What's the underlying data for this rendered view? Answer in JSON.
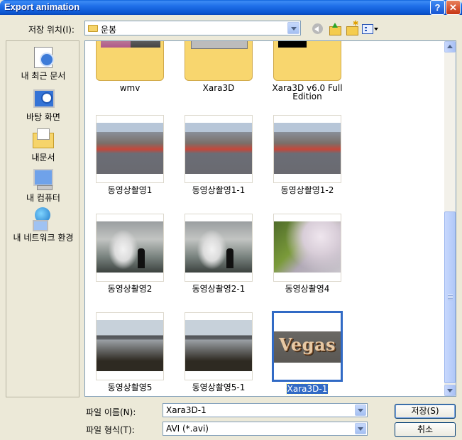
{
  "window": {
    "title": "Export animation",
    "help_label": "?",
    "close_label": "✕"
  },
  "save_in": {
    "label": "저장 위치(I):",
    "value": "운봉"
  },
  "places": [
    {
      "label": "내 최근 문서",
      "icon": "recent-documents-icon"
    },
    {
      "label": "바탕 화면",
      "icon": "desktop-icon"
    },
    {
      "label": "내문서",
      "icon": "my-documents-icon"
    },
    {
      "label": "내 컴퓨터",
      "icon": "my-computer-icon"
    },
    {
      "label": "내 네트워크 환경",
      "icon": "my-network-icon"
    }
  ],
  "files": [
    {
      "label": "wmv",
      "type": "folder"
    },
    {
      "label": "Xara3D",
      "type": "folder"
    },
    {
      "label": "Xara3D v6.0 Full Edition",
      "type": "folder"
    },
    {
      "label": "동영상촬영1",
      "type": "video"
    },
    {
      "label": "동영상촬영1-1",
      "type": "video"
    },
    {
      "label": "동영상촬영1-2",
      "type": "video"
    },
    {
      "label": "동영상촬영2",
      "type": "video"
    },
    {
      "label": "동영상촬영2-1",
      "type": "video"
    },
    {
      "label": "동영상촬영4",
      "type": "video"
    },
    {
      "label": "동영상촬영5",
      "type": "video"
    },
    {
      "label": "동영상촬영5-1",
      "type": "video"
    },
    {
      "label": "Xara3D-1",
      "type": "video",
      "selected": true,
      "thumb_text": "Vegas"
    }
  ],
  "file_name": {
    "label": "파일 이름(N):",
    "value": "Xara3D-1"
  },
  "file_type": {
    "label": "파일 형식(T):",
    "value": "AVI (*.avi)"
  },
  "buttons": {
    "save": "저장(S)",
    "cancel": "취소"
  },
  "colors": {
    "titlebar": "#0b55d0",
    "selection": "#316ac5",
    "dialog_bg": "#ece9d8"
  }
}
